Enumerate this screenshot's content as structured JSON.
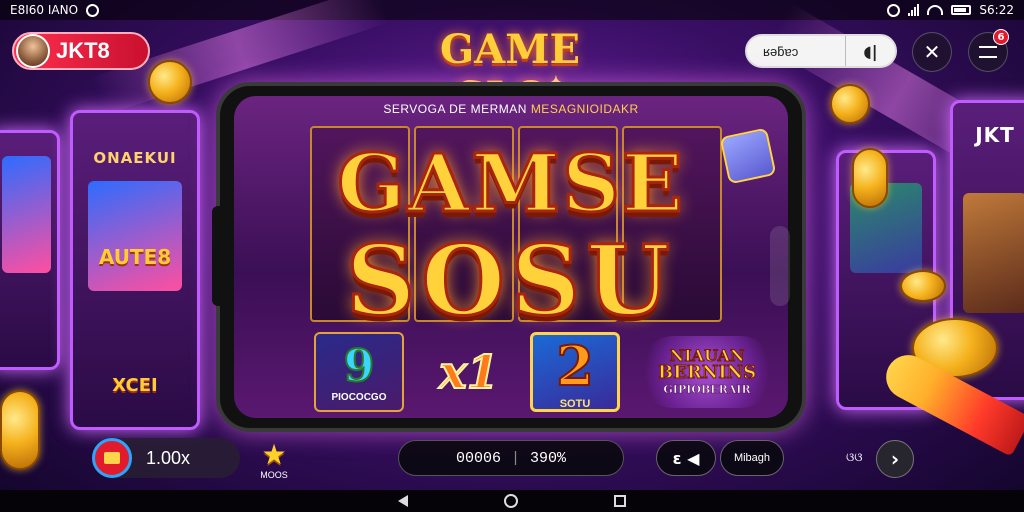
{
  "status_bar": {
    "left_text": "E8I60 IANO",
    "right_text": "S6:22"
  },
  "brand": {
    "name": "JKT8"
  },
  "logo": {
    "title": "GAME SLO",
    "star": "✦"
  },
  "top_controls": {
    "search_text": "ʁəƃɐɔ",
    "search_button": "◖|",
    "tools_icon": "✕",
    "menu_badge": "6"
  },
  "background": {
    "left_machine_title": "ONAEKUI",
    "left_machine_sub": "AUTE8",
    "left_machine_lower": "XCEI",
    "right_machine_title": "JKT"
  },
  "game": {
    "subtitle_a": "SERVOGA DE MERMAN",
    "subtitle_b": "MESAGNIOIDAKR",
    "title_line1": "GAMSE",
    "title_line2": "SOSU",
    "tiles": [
      {
        "symbol": "9",
        "label": "PIOCOCGO"
      },
      {
        "symbol": "x1",
        "label": ""
      },
      {
        "symbol": "2",
        "label": "SOTU"
      }
    ],
    "promo_line1": "NIAUAN",
    "promo_line2": "BERNINS",
    "promo_line3": "GIPIOBERAIR"
  },
  "bottom_hud": {
    "balance": "1.00x",
    "star_label": "MOOS",
    "counter_left": "00006",
    "counter_right": "390%",
    "ctrl_label": "ɛ ◀",
    "text_button": "Mibagh",
    "small_num": "ଓଓ",
    "next_icon": "›"
  },
  "colors": {
    "brand_red": "#e21b2c",
    "gold": "#ffd13a",
    "purple": "#7a2bb0"
  }
}
